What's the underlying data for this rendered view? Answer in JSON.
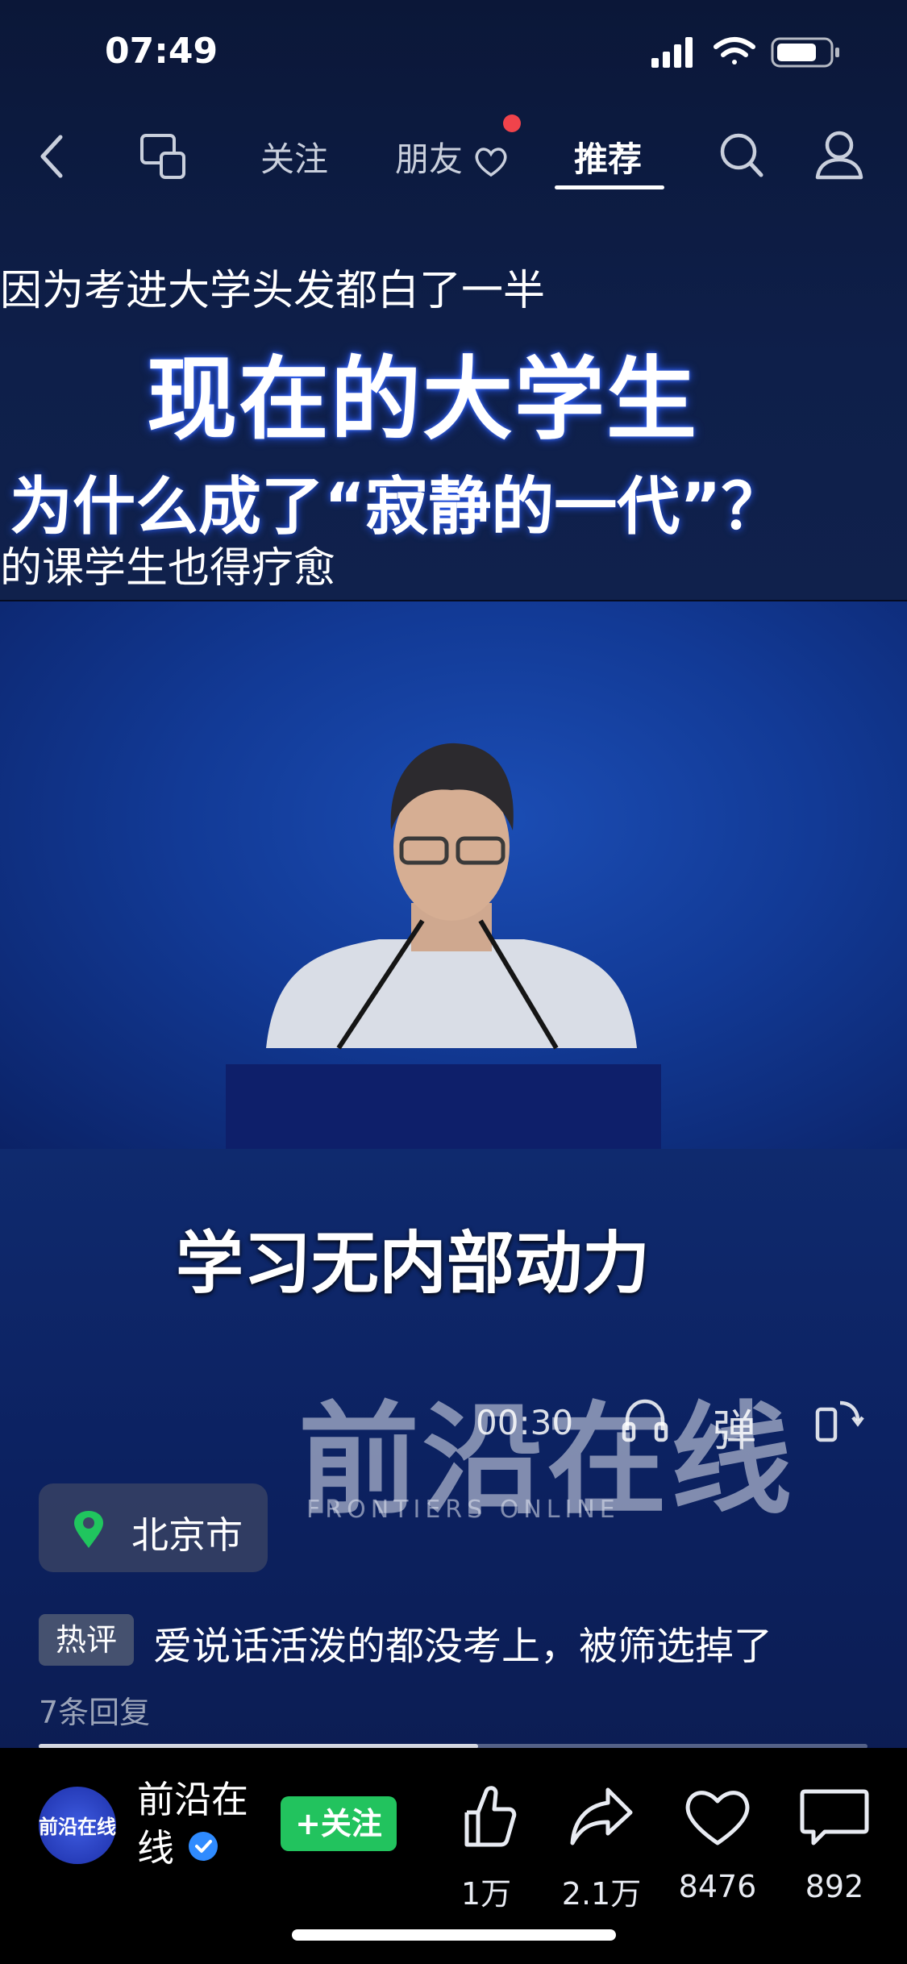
{
  "status_bar": {
    "time": "07:49"
  },
  "nav": {
    "tabs": [
      {
        "label": "关注"
      },
      {
        "label": "朋友"
      },
      {
        "label": "推荐"
      }
    ]
  },
  "captions": {
    "line1": "因为考进大学头发都白了一半",
    "headline1": "现在的大学生",
    "headline2": "为什么成了“寂静的一代”？",
    "line2": "的课学生也得疗愈",
    "subtitle": "学习无内部动力"
  },
  "watermark": {
    "cn": "前沿在线",
    "en": "FRONTIERS ONLINE"
  },
  "player": {
    "time": "00:30",
    "danmaku_label": "弹",
    "progress": 0.53
  },
  "location": {
    "label": "北京市"
  },
  "hot_comment": {
    "badge": "热评",
    "text": "爱说话活泼的都没考上，被筛选掉了",
    "reply_count": "7条回复"
  },
  "account": {
    "name": "前沿在线",
    "avatar_text": "前沿在线",
    "follow_label": "+关注"
  },
  "stats": {
    "like": "1万",
    "share": "2.1万",
    "favorite": "8476",
    "comment": "892"
  },
  "colors": {
    "follow_green": "#22c35e",
    "notify_red": "#f0434b",
    "verified_blue": "#2f8bff"
  }
}
